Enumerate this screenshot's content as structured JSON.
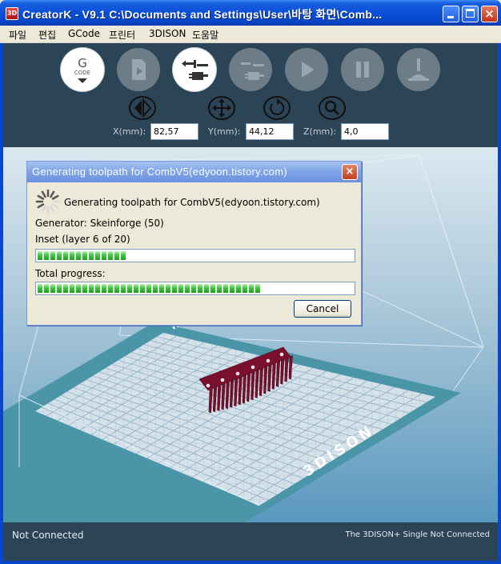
{
  "window": {
    "icon_text": "3D",
    "title": "CreatorK - V9.1  C:\\Documents and Settings\\User\\바탕 화면\\Comb..."
  },
  "menu": [
    "파일",
    "편집",
    "GCode",
    "프린터",
    "3DISON",
    "도움말"
  ],
  "toolbar": {
    "gcode_label": "G",
    "gcode_sublabel": "CODE",
    "buttons": [
      {
        "icon": "gcode-icon",
        "state": "active"
      },
      {
        "icon": "sd-card-icon",
        "state": "inactive"
      },
      {
        "icon": "connect-icon",
        "state": "active"
      },
      {
        "icon": "disconnect-icon",
        "state": "inactive"
      },
      {
        "icon": "play-icon",
        "state": "inactive"
      },
      {
        "icon": "pause-icon",
        "state": "inactive"
      },
      {
        "icon": "stop-icon",
        "state": "inactive"
      }
    ],
    "view_buttons": [
      "mirror-icon",
      "move-icon",
      "rotate-icon",
      "zoom-icon"
    ]
  },
  "coordinates": {
    "x_label": "X(mm):",
    "x_value": "82,57",
    "y_label": "Y(mm):",
    "y_value": "44,12",
    "z_label": "Z(mm):",
    "z_value": "4,0"
  },
  "viewport": {
    "bed_label": "3DISON"
  },
  "dialog": {
    "title": "Generating toolpath for CombV5(edyoon.tistory.com)",
    "close_label": "×",
    "message": "Generating toolpath for CombV5(edyoon.tistory.com)",
    "generator": "Generator: Skeinforge (50)",
    "step": "Inset (layer 6 of 20)",
    "step_progress": 0.29,
    "total_label": "Total progress:",
    "total_progress": 0.73,
    "cancel_label": "Cancel"
  },
  "status": {
    "connection": "Not Connected",
    "printer_status": "The 3DISON+ Single Not Connected"
  },
  "colors": {
    "toolbar_bg": "#2c4556",
    "progress_green": "#3cc83c",
    "comb_color": "#7a0f2e"
  }
}
